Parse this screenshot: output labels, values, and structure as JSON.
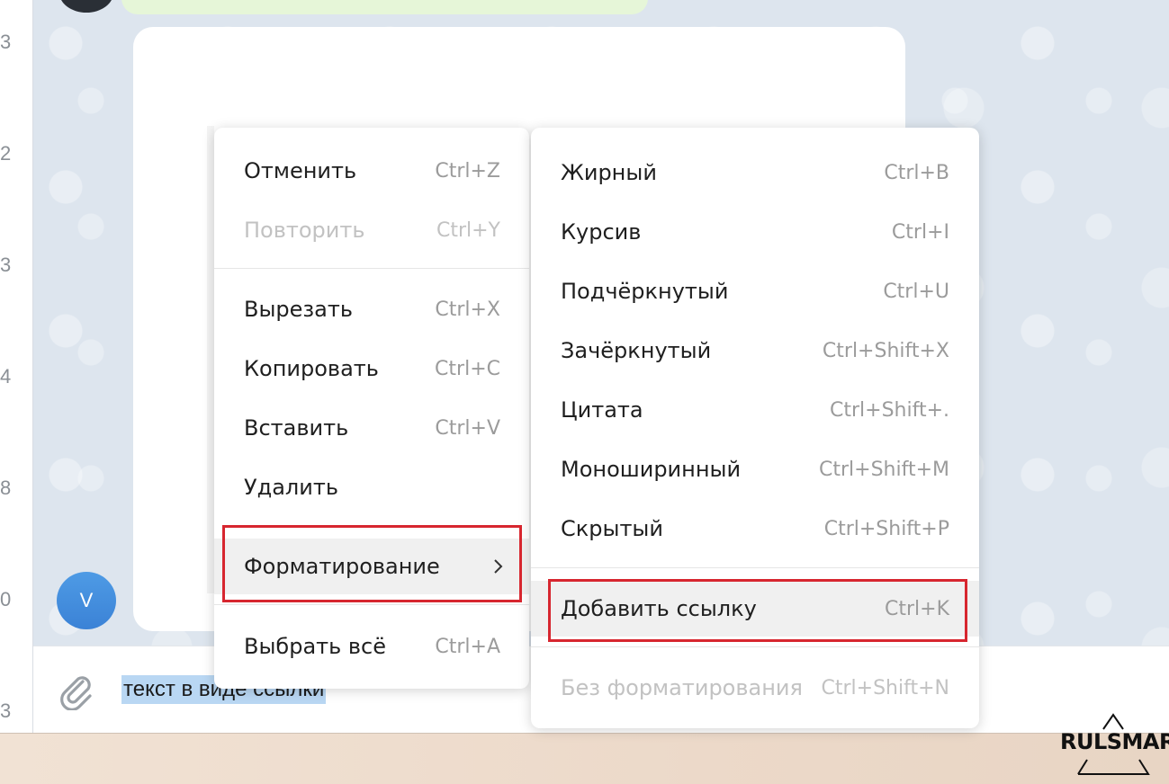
{
  "gutter": {
    "numbers": [
      "3",
      "2",
      "3",
      "4",
      "8",
      "0",
      "3"
    ]
  },
  "avatar": {
    "letter": "V"
  },
  "input": {
    "text": "текст в виде ссылки"
  },
  "context_menu": {
    "items": [
      {
        "label": "Отменить",
        "shortcut": "Ctrl+Z",
        "enabled": true
      },
      {
        "label": "Повторить",
        "shortcut": "Ctrl+Y",
        "enabled": false
      },
      {
        "label": "Вырезать",
        "shortcut": "Ctrl+X",
        "enabled": true
      },
      {
        "label": "Копировать",
        "shortcut": "Ctrl+C",
        "enabled": true
      },
      {
        "label": "Вставить",
        "shortcut": "Ctrl+V",
        "enabled": true
      },
      {
        "label": "Удалить",
        "shortcut": "",
        "enabled": true
      },
      {
        "label": "Форматирование",
        "shortcut": "",
        "enabled": true,
        "submenu": true,
        "highlighted": true
      },
      {
        "label": "Выбрать всё",
        "shortcut": "Ctrl+A",
        "enabled": true
      }
    ]
  },
  "format_submenu": {
    "items": [
      {
        "label": "Жирный",
        "shortcut": "Ctrl+B",
        "enabled": true
      },
      {
        "label": "Курсив",
        "shortcut": "Ctrl+I",
        "enabled": true
      },
      {
        "label": "Подчёркнутый",
        "shortcut": "Ctrl+U",
        "enabled": true
      },
      {
        "label": "Зачёркнутый",
        "shortcut": "Ctrl+Shift+X",
        "enabled": true
      },
      {
        "label": "Цитата",
        "shortcut": "Ctrl+Shift+.",
        "enabled": true
      },
      {
        "label": "Моноширинный",
        "shortcut": "Ctrl+Shift+M",
        "enabled": true
      },
      {
        "label": "Скрытый",
        "shortcut": "Ctrl+Shift+P",
        "enabled": true
      },
      {
        "label": "Добавить ссылку",
        "shortcut": "Ctrl+K",
        "enabled": true,
        "highlighted": true
      },
      {
        "label": "Без форматирования",
        "shortcut": "Ctrl+Shift+N",
        "enabled": false
      }
    ]
  },
  "watermark": {
    "text": "RULSMART"
  },
  "colors": {
    "highlight_border": "#d7262f",
    "selection": "#b9d7f3",
    "avatar": "#3b82d6"
  },
  "icons": {
    "attach": "paperclip-icon",
    "submenu": "chevron-right-icon"
  }
}
